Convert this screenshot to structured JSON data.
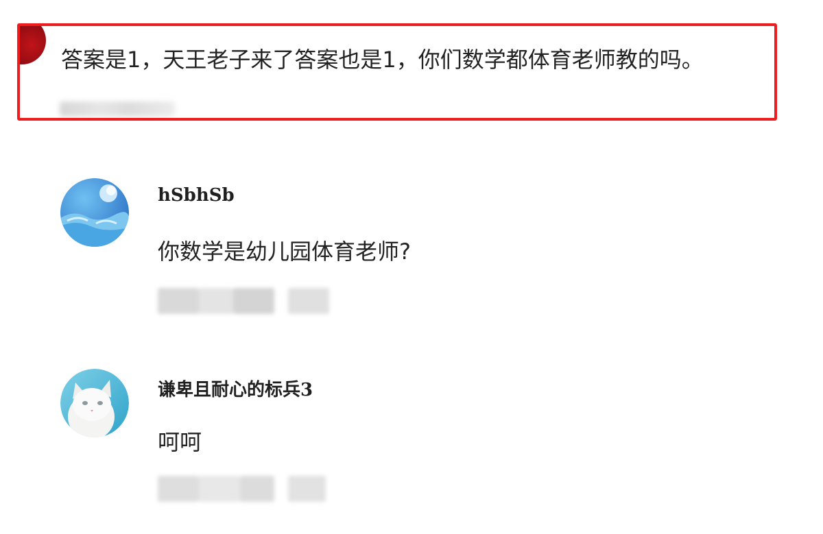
{
  "highlighted_comment": {
    "text": "答案是1，天王老子来了答案也是1，你们数学都体育老师教的吗。",
    "border_color": "#ee1c1c"
  },
  "replies": [
    {
      "username": "hSbhSb",
      "text": "你数学是幼儿园体育老师?",
      "avatar_icon": "blue-wave-avatar"
    },
    {
      "username": "谦卑且耐心的标兵3",
      "text": "呵呵",
      "avatar_icon": "white-cat-avatar"
    }
  ]
}
